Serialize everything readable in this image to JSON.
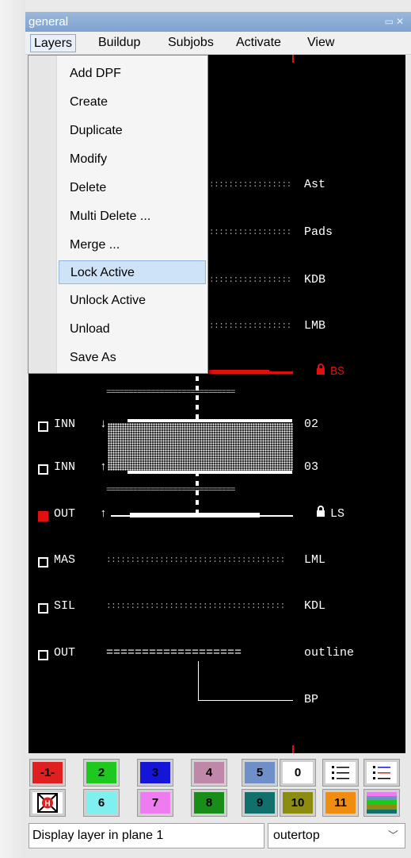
{
  "window": {
    "title": "general"
  },
  "menubar": [
    "Layers",
    "Buildup",
    "Subjobs",
    "Activate",
    "View"
  ],
  "layers_menu": {
    "items": [
      "Add DPF",
      "Create",
      "Duplicate",
      "Modify",
      "Delete",
      "Multi Delete ...",
      "Merge ...",
      "Lock Active",
      "Unlock Active",
      "Unload",
      "Save As"
    ],
    "highlighted": "Lock Active"
  },
  "layers": [
    {
      "name": "Ast"
    },
    {
      "name": "Pads"
    },
    {
      "name": "KDB"
    },
    {
      "name": "LMB"
    },
    {
      "name": "BS",
      "locked": true,
      "color": "#e01010"
    },
    {
      "name": "02",
      "side": "INN",
      "arrow": "↓"
    },
    {
      "name": "03",
      "side": "INN",
      "arrow": "↑"
    },
    {
      "name": "LS",
      "side": "OUT",
      "arrow": "↑",
      "locked": true,
      "checked": true
    },
    {
      "name": "LML",
      "side": "MAS"
    },
    {
      "name": "KDL",
      "side": "SIL"
    },
    {
      "name": "outline",
      "side": "OUT"
    },
    {
      "name": "BP"
    }
  ],
  "palette": {
    "row1": [
      {
        "label": "-1-",
        "color": "#e02020"
      },
      {
        "label": "2",
        "color": "#1ec81e"
      },
      {
        "label": "3",
        "color": "#1515d8"
      },
      {
        "label": "4",
        "color": "#c088a8"
      },
      {
        "label": "5",
        "color": "#6f8fc8"
      },
      {
        "label": "0",
        "color": "#ffffff"
      }
    ],
    "row2": [
      {
        "label": "6",
        "color": "#7ff0f0"
      },
      {
        "label": "7",
        "color": "#ee7cf0"
      },
      {
        "label": "8",
        "color": "#1a8c1a"
      },
      {
        "label": "9",
        "color": "#12706c"
      },
      {
        "label": "10",
        "color": "#8c8c10"
      },
      {
        "label": "11",
        "color": "#f08c10"
      }
    ],
    "icons": [
      "list-icon",
      "colored-list-icon",
      "no-layer-icon",
      "all-colors-icon"
    ]
  },
  "status": {
    "message": "Display layer in plane 1",
    "plane_value": "outertop"
  }
}
